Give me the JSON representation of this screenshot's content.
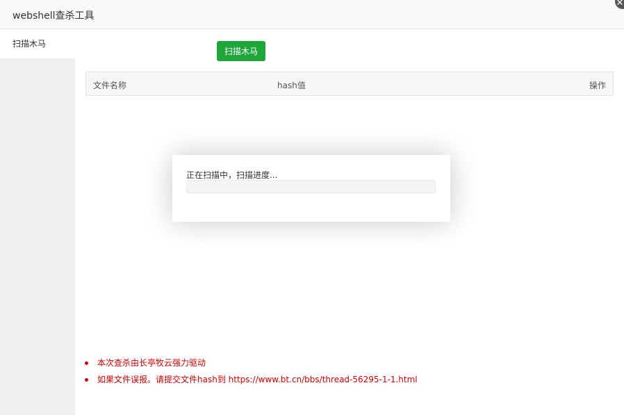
{
  "window": {
    "title": "webshell查杀工具",
    "close_icon": "close-icon"
  },
  "sidebar": {
    "items": [
      {
        "label": "扫描木马",
        "active": true
      }
    ]
  },
  "toolbar": {
    "scan_label": "扫描木马"
  },
  "table": {
    "columns": [
      "文件名称",
      "hash值",
      "操作"
    ],
    "rows": []
  },
  "notes": [
    "本次查杀由长亭牧云强力驱动",
    "如果文件误报。请提交文件hash到 https://www.bt.cn/bbs/thread-56295-1-1.html"
  ],
  "progress": {
    "text": "正在扫描中，扫描进度...",
    "percent": 0
  },
  "colors": {
    "accent": "#20a53a",
    "note": "#cc0000"
  }
}
